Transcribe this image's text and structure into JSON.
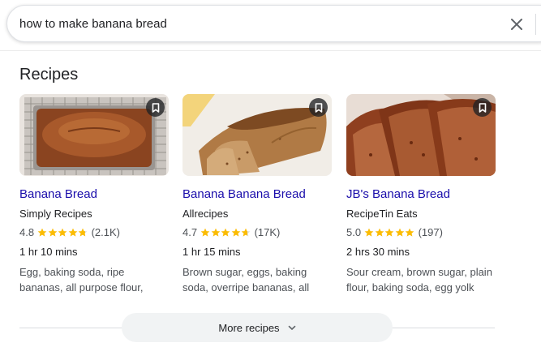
{
  "search": {
    "query": "how to make banana bread"
  },
  "section": {
    "title": "Recipes"
  },
  "recipes": [
    {
      "title": "Banana Bread",
      "source": "Simply Recipes",
      "rating": "4.8",
      "rating_value": 4.8,
      "reviews": "(2.1K)",
      "time": "1 hr 10 mins",
      "ingredients": "Egg, baking soda, ripe bananas, all purpose flour,"
    },
    {
      "title": "Banana Banana Bread",
      "source": "Allrecipes",
      "rating": "4.7",
      "rating_value": 4.7,
      "reviews": "(17K)",
      "time": "1 hr 15 mins",
      "ingredients": "Brown sugar, eggs, baking soda, overripe bananas, all"
    },
    {
      "title": "JB's Banana Bread",
      "source": "RecipeTin Eats",
      "rating": "5.0",
      "rating_value": 5.0,
      "reviews": "(197)",
      "time": "2 hrs 30 mins",
      "ingredients": "Sour cream, brown sugar, plain flour, baking soda, egg yolk"
    }
  ],
  "more_button": {
    "label": "More recipes"
  },
  "icons": {
    "clear": "close-icon",
    "save": "bookmark-icon",
    "star": "star-icon",
    "expand": "chevron-down-icon"
  },
  "colors": {
    "link": "#1a0dab",
    "star": "#fbbc04",
    "button_bg": "#f1f3f4"
  }
}
